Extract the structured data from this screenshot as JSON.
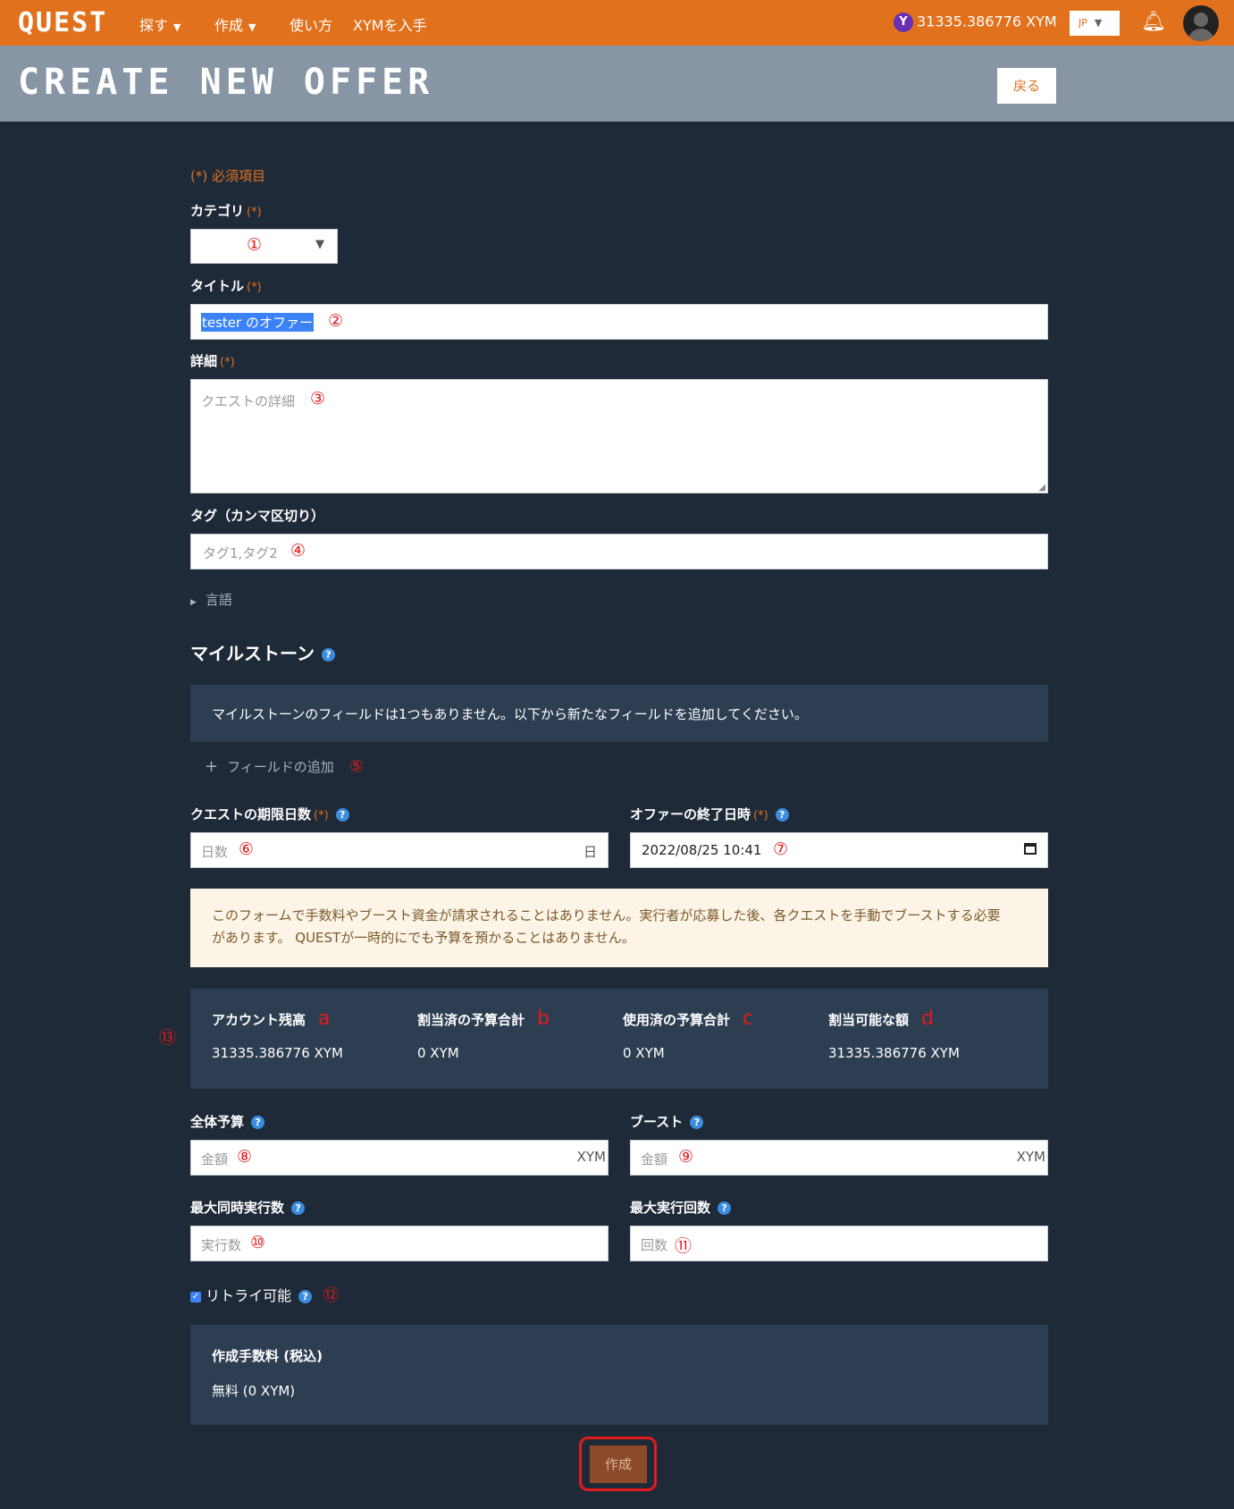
{
  "topbar": {
    "logo": "QUEST",
    "nav": [
      {
        "label": "探す",
        "has_dropdown": true
      },
      {
        "label": "作成",
        "has_dropdown": true
      },
      {
        "label": "使い方",
        "has_dropdown": false
      },
      {
        "label": "XYMを入手",
        "has_dropdown": false
      }
    ],
    "balance": "31335.386776 XYM",
    "language": "JP"
  },
  "header": {
    "title": "CREATE NEW OFFER",
    "back_label": "戻る"
  },
  "form": {
    "required_note": "(*) 必須項目",
    "required_mark": "(*)",
    "category": {
      "label": "カテゴリ",
      "value": "",
      "marker": "①"
    },
    "title": {
      "label": "タイトル",
      "value": "tester のオファー",
      "marker": "②"
    },
    "detail": {
      "label": "詳細",
      "placeholder": "クエストの詳細",
      "marker": "③"
    },
    "tags": {
      "label": "タグ（カンマ区切り）",
      "placeholder": "タグ1,タグ2",
      "marker": "④"
    },
    "language_toggle": "言語",
    "milestone": {
      "heading": "マイルストーン",
      "empty_message": "マイルストーンのフィールドは1つもありません。以下から新たなフィールドを追加してください。",
      "add_label": "フィールドの追加",
      "marker": "⑤"
    },
    "quest_days": {
      "label": "クエストの期限日数",
      "placeholder": "日数",
      "suffix": "日",
      "marker": "⑥"
    },
    "end_date": {
      "label": "オファーの終了日時",
      "value": "2022/08/25 10:41",
      "marker": "⑦"
    },
    "notice": "このフォームで手数料やブースト資金が請求されることはありません。実行者が応募した後、各クエストを手動でブーストする必要があります。 QUESTが一時的にでも予算を預かることはありません。",
    "balance_panel": {
      "marker": "⑬",
      "items": [
        {
          "label": "アカウント残高",
          "letter": "a",
          "value": "31335.386776 XYM"
        },
        {
          "label": "割当済の予算合計",
          "letter": "b",
          "value": "0 XYM"
        },
        {
          "label": "使用済の予算合計",
          "letter": "c",
          "value": "0 XYM"
        },
        {
          "label": "割当可能な額",
          "letter": "d",
          "value": "31335.386776 XYM"
        }
      ]
    },
    "total_budget": {
      "label": "全体予算",
      "placeholder": "金額",
      "suffix": "XYM",
      "marker": "⑧"
    },
    "boost": {
      "label": "ブースト",
      "placeholder": "金額",
      "suffix": "XYM",
      "marker": "⑨"
    },
    "max_concurrent": {
      "label": "最大同時実行数",
      "placeholder": "実行数",
      "marker": "⑩"
    },
    "max_runs": {
      "label": "最大実行回数",
      "placeholder": "回数",
      "marker": "⑪"
    },
    "retry": {
      "label": "リトライ可能",
      "checked": true,
      "marker": "⑫"
    },
    "fee": {
      "label": "作成手数料 (税込)",
      "value": "無料 (0 XYM)"
    },
    "submit_label": "作成"
  },
  "colors": {
    "topbar": "#e2711d",
    "header": "#8795a5",
    "background": "#1f2a38",
    "panel": "#2d3e52",
    "annotation": "#e21b1b"
  }
}
